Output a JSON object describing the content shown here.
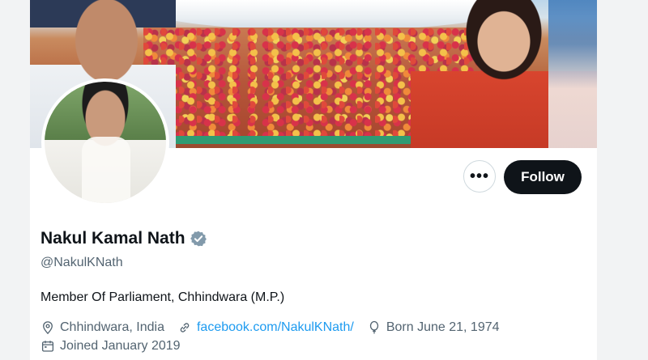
{
  "profile": {
    "name": "Nakul Kamal Nath",
    "handle": "@NakulKNath",
    "bio": "Member Of Parliament, Chhindwara (M.P.)",
    "location": "Chhindwara, India",
    "website": "facebook.com/NakulKNath/",
    "birthday": "Born June 21, 1974",
    "joined": "Joined January 2019"
  },
  "actions": {
    "more_label": "•••",
    "follow_label": "Follow"
  },
  "icons": {
    "verified": "verified-badge-icon",
    "location": "location-pin-icon",
    "link": "link-icon",
    "birthday": "balloon-icon",
    "joined": "calendar-icon"
  },
  "colors": {
    "accent": "#1d9bf0",
    "follow_bg": "#0f1419",
    "verified": "#829aab",
    "secondary_text": "#536471"
  }
}
